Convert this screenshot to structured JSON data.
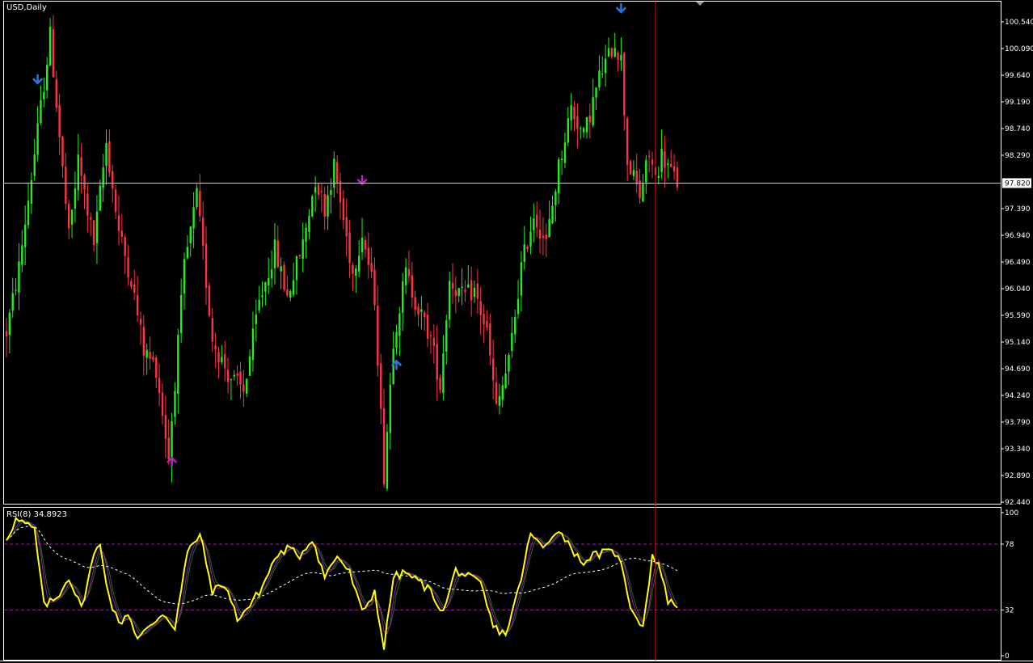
{
  "colors": {
    "background": "#000000",
    "frame": "#ffffff",
    "bull": "#22ee22",
    "bear": "#ff3344",
    "vline": "#cc1111",
    "hline": "#c8c8c8",
    "rsi_main": "#ffff00",
    "rsi_magenta": "#a020a0",
    "rsi_green": "#117711",
    "rsi_signal": "#ffffff",
    "level": "#a020a0",
    "arrow_blue": "#2277dd",
    "arrow_magenta": "#bb22bb"
  },
  "chart_data": [
    {
      "type": "candlestick",
      "title": "USD,Daily",
      "ylim": [
        92.44,
        100.77
      ],
      "yticks": [
        "100.540",
        "100.090",
        "99.640",
        "99.190",
        "98.740",
        "98.290",
        "97.820",
        "97.390",
        "96.940",
        "96.490",
        "96.040",
        "95.590",
        "95.140",
        "94.690",
        "94.240",
        "93.790",
        "93.340",
        "92.890",
        "92.440"
      ],
      "current_price": "97.820",
      "current_price_value": 97.82,
      "anchors": [
        [
          0,
          95.3
        ],
        [
          4,
          96.4
        ],
        [
          10,
          98.7
        ],
        [
          14,
          100.3
        ],
        [
          20,
          96.9
        ],
        [
          23,
          98.2
        ],
        [
          28,
          96.8
        ],
        [
          32,
          98.5
        ],
        [
          36,
          97.0
        ],
        [
          40,
          96.2
        ],
        [
          44,
          95.0
        ],
        [
          48,
          94.7
        ],
        [
          52,
          93.2
        ],
        [
          57,
          96.4
        ],
        [
          61,
          97.6
        ],
        [
          66,
          95.2
        ],
        [
          71,
          94.6
        ],
        [
          76,
          94.3
        ],
        [
          81,
          95.8
        ],
        [
          86,
          96.7
        ],
        [
          90,
          95.9
        ],
        [
          95,
          96.8
        ],
        [
          99,
          97.9
        ],
        [
          102,
          97.4
        ],
        [
          105,
          98.1
        ],
        [
          108,
          97.2
        ],
        [
          111,
          96.3
        ],
        [
          114,
          97.0
        ],
        [
          118,
          95.9
        ],
        [
          121,
          92.9
        ],
        [
          124,
          95.2
        ],
        [
          128,
          96.3
        ],
        [
          132,
          95.7
        ],
        [
          136,
          95.2
        ],
        [
          139,
          94.4
        ],
        [
          142,
          96.2
        ],
        [
          146,
          95.9
        ],
        [
          150,
          96.0
        ],
        [
          154,
          95.3
        ],
        [
          157,
          94.0
        ],
        [
          161,
          94.8
        ],
        [
          165,
          96.4
        ],
        [
          169,
          97.3
        ],
        [
          173,
          96.8
        ],
        [
          177,
          98.1
        ],
        [
          181,
          99.1
        ],
        [
          185,
          98.6
        ],
        [
          190,
          99.6
        ],
        [
          195,
          100.2
        ],
        [
          197,
          99.9
        ],
        [
          199,
          98.2
        ],
        [
          203,
          97.6
        ],
        [
          206,
          98.3
        ],
        [
          208,
          97.9
        ],
        [
          210,
          98.3
        ],
        [
          212,
          98.1
        ],
        [
          215,
          97.82
        ]
      ],
      "markers": [
        {
          "bar": 10,
          "kind": "down",
          "color": "blue"
        },
        {
          "bar": 53,
          "kind": "up",
          "color": "magenta"
        },
        {
          "bar": 114,
          "kind": "down",
          "color": "magenta"
        },
        {
          "bar": 125,
          "kind": "up",
          "color": "blue"
        },
        {
          "bar": 197,
          "kind": "down",
          "color": "blue"
        }
      ],
      "vline_bar": 208
    },
    {
      "type": "line",
      "title": "RSI(8) 34.8923",
      "ylim": [
        0,
        100
      ],
      "yticks": [
        "100",
        "78",
        "32",
        "0"
      ],
      "levels": [
        78,
        32
      ],
      "series": [
        {
          "name": "RSI(8)",
          "anchors": [
            [
              0,
              82
            ],
            [
              3,
              95
            ],
            [
              6,
              92
            ],
            [
              9,
              88
            ],
            [
              12,
              35
            ],
            [
              16,
              40
            ],
            [
              20,
              55
            ],
            [
              24,
              33
            ],
            [
              28,
              70
            ],
            [
              30,
              78
            ],
            [
              33,
              40
            ],
            [
              36,
              22
            ],
            [
              39,
              30
            ],
            [
              42,
              12
            ],
            [
              46,
              20
            ],
            [
              50,
              30
            ],
            [
              54,
              20
            ],
            [
              58,
              72
            ],
            [
              62,
              85
            ],
            [
              66,
              45
            ],
            [
              70,
              50
            ],
            [
              74,
              26
            ],
            [
              78,
              35
            ],
            [
              82,
              48
            ],
            [
              86,
              68
            ],
            [
              90,
              75
            ],
            [
              94,
              70
            ],
            [
              98,
              82
            ],
            [
              102,
              55
            ],
            [
              106,
              70
            ],
            [
              110,
              58
            ],
            [
              114,
              30
            ],
            [
              118,
              45
            ],
            [
              121,
              5
            ],
            [
              124,
              55
            ],
            [
              128,
              58
            ],
            [
              132,
              52
            ],
            [
              136,
              45
            ],
            [
              140,
              30
            ],
            [
              144,
              60
            ],
            [
              148,
              55
            ],
            [
              152,
              50
            ],
            [
              156,
              20
            ],
            [
              160,
              15
            ],
            [
              164,
              45
            ],
            [
              168,
              85
            ],
            [
              172,
              75
            ],
            [
              176,
              88
            ],
            [
              180,
              80
            ],
            [
              184,
              65
            ],
            [
              188,
              70
            ],
            [
              192,
              72
            ],
            [
              196,
              72
            ],
            [
              200,
              35
            ],
            [
              204,
              20
            ],
            [
              207,
              70
            ],
            [
              210,
              58
            ],
            [
              212,
              38
            ],
            [
              215,
              35
            ]
          ]
        }
      ],
      "value_label": "34.8923"
    }
  ]
}
